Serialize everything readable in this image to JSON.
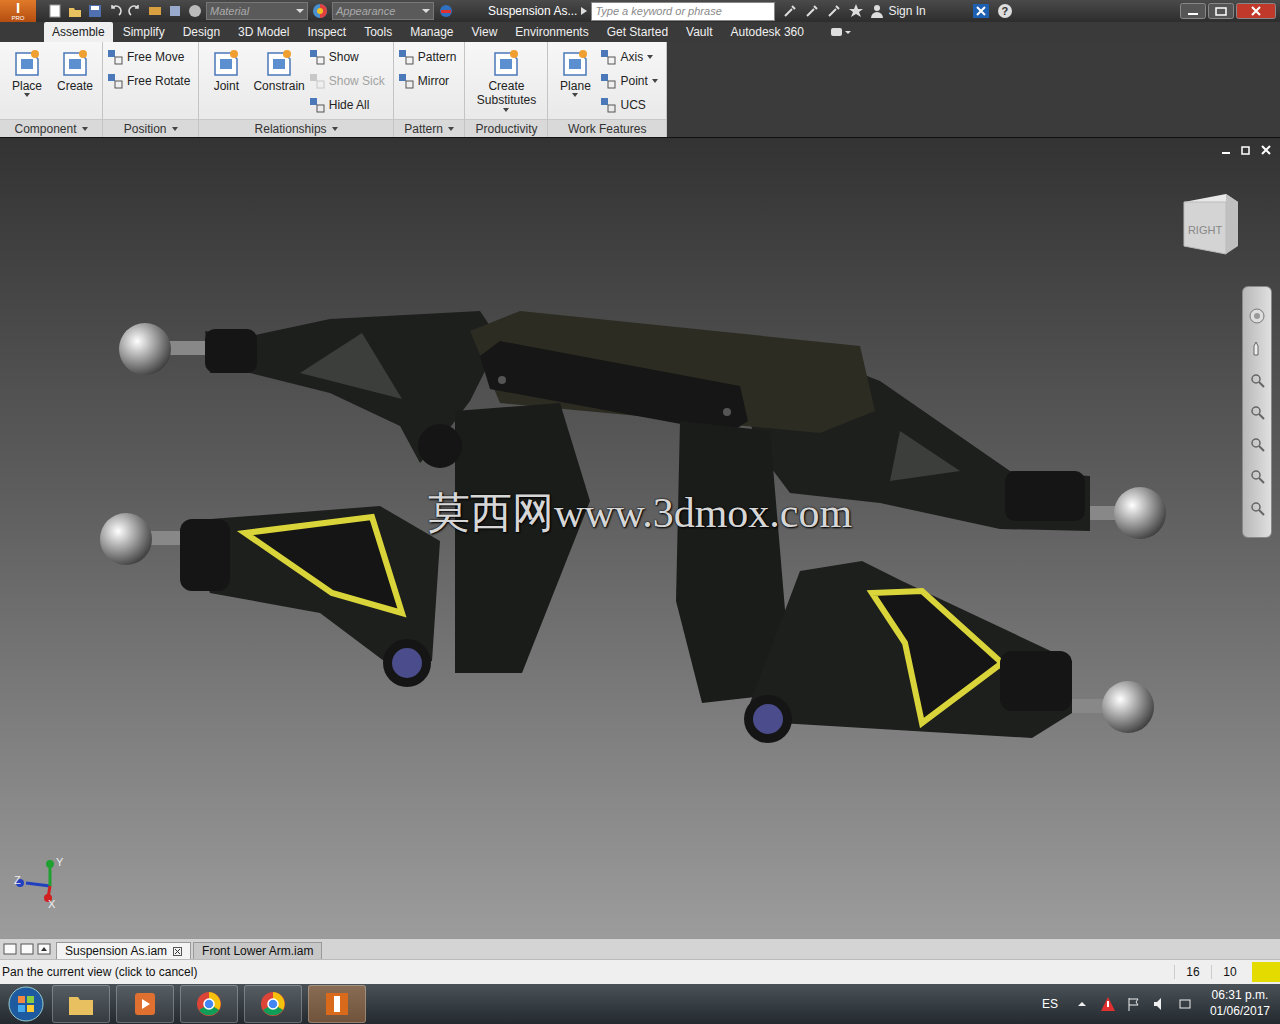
{
  "app": {
    "logo": "I",
    "edition": "PRO"
  },
  "titlebar": {
    "material": "Material",
    "appearance": "Appearance",
    "document": "Suspension As...",
    "search_placeholder": "Type a keyword or phrase",
    "sign_in": "Sign In",
    "help": "?"
  },
  "tabs": [
    {
      "label": "Assemble",
      "selected": true
    },
    {
      "label": "Simplify",
      "selected": false
    },
    {
      "label": "Design",
      "selected": false
    },
    {
      "label": "3D Model",
      "selected": false
    },
    {
      "label": "Inspect",
      "selected": false
    },
    {
      "label": "Tools",
      "selected": false
    },
    {
      "label": "Manage",
      "selected": false
    },
    {
      "label": "View",
      "selected": false
    },
    {
      "label": "Environments",
      "selected": false
    },
    {
      "label": "Get Started",
      "selected": false
    },
    {
      "label": "Vault",
      "selected": false
    },
    {
      "label": "Autodesk 360",
      "selected": false
    }
  ],
  "ribbon": {
    "panels": [
      {
        "title": "Component",
        "menu": true,
        "tools": [
          {
            "label": "Place",
            "kind": "large",
            "disabled": false,
            "dropdown": true
          },
          {
            "label": "Create",
            "kind": "large",
            "disabled": false,
            "dropdown": false
          }
        ]
      },
      {
        "title": "Position",
        "menu": true,
        "tools": [
          {
            "label": "Free Move",
            "kind": "small",
            "disabled": false,
            "dropdown": false
          },
          {
            "label": "Free Rotate",
            "kind": "small",
            "disabled": false,
            "dropdown": false
          }
        ]
      },
      {
        "title": "Relationships",
        "menu": true,
        "tools": [
          {
            "label": "Joint",
            "kind": "large",
            "disabled": false,
            "dropdown": false
          },
          {
            "label": "Constrain",
            "kind": "large",
            "disabled": false,
            "dropdown": false
          },
          {
            "label": "Show",
            "kind": "small",
            "disabled": false,
            "dropdown": false
          },
          {
            "label": "Show Sick",
            "kind": "small",
            "disabled": true,
            "dropdown": false
          },
          {
            "label": "Hide All",
            "kind": "small",
            "disabled": false,
            "dropdown": false
          }
        ]
      },
      {
        "title": "Pattern",
        "menu": true,
        "tools": [
          {
            "label": "Pattern",
            "kind": "small",
            "disabled": false,
            "dropdown": false
          },
          {
            "label": "Mirror",
            "kind": "small",
            "disabled": false,
            "dropdown": false
          }
        ]
      },
      {
        "title": "Productivity",
        "menu": false,
        "tools": [
          {
            "label": "Create Substitutes",
            "kind": "large",
            "disabled": false,
            "dropdown": true
          }
        ]
      },
      {
        "title": "Work Features",
        "menu": false,
        "tools": [
          {
            "label": "Plane",
            "kind": "large",
            "disabled": false,
            "dropdown": true
          },
          {
            "label": "Axis",
            "kind": "small",
            "disabled": false,
            "dropdown": true
          },
          {
            "label": "Point",
            "kind": "small",
            "disabled": false,
            "dropdown": true
          },
          {
            "label": "UCS",
            "kind": "small",
            "disabled": false,
            "dropdown": false
          }
        ]
      }
    ]
  },
  "viewport": {
    "view_cube": "RIGHT",
    "watermark": "莫西网www.3dmox.com",
    "axes": [
      {
        "label": "Z",
        "color": "#2040c0"
      },
      {
        "label": "Y",
        "color": "#20a030"
      },
      {
        "label": "X",
        "color": "#d02020"
      }
    ]
  },
  "document_tabs": [
    {
      "label": "Suspension As.iam",
      "selected": true,
      "closable": true
    },
    {
      "label": "Front Lower Arm.iam",
      "selected": false,
      "closable": false
    }
  ],
  "status_bar": {
    "message": "Pan the current view (click to cancel)",
    "counts": [
      "16",
      "10"
    ]
  },
  "taskbar": {
    "language": "ES",
    "time": "06:31 p.m.",
    "date": "01/06/2017"
  }
}
